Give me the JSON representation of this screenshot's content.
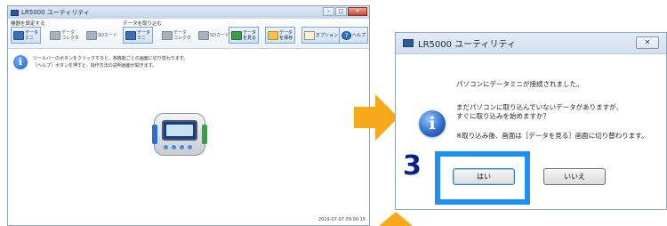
{
  "app": {
    "title": "LR5000 ユーティリティ",
    "window_buttons": {
      "minimize": "–",
      "maximize": "□",
      "close": "✕"
    },
    "toolbar": {
      "group1_label": "機器を設定する",
      "group2_label": "データを取り込む",
      "buttons": [
        {
          "label": "データ\nミニ",
          "icon": "data-mini-icon",
          "active": true
        },
        {
          "label": "データ\nコレクタ",
          "icon": "data-collector-icon",
          "active": false
        },
        {
          "label": "SDカード",
          "icon": "sd-card-icon",
          "active": false
        },
        {
          "label": "データ\nミニ",
          "icon": "data-mini-icon",
          "active": true
        },
        {
          "label": "データ\nコレクタ",
          "icon": "data-collector-icon",
          "active": false
        },
        {
          "label": "SDカード",
          "icon": "sd-card-icon",
          "active": false
        },
        {
          "label": "データ\nを見る",
          "icon": "view-data-icon",
          "active": true
        },
        {
          "label": "データ\nを保存",
          "icon": "save-data-icon",
          "active": true
        },
        {
          "label": "オプション",
          "icon": "options-icon",
          "active": true
        },
        {
          "label": "ヘルプ",
          "icon": "help-icon",
          "active": true
        }
      ]
    },
    "info_line1": "ツールバーのボタンをクリックすると、各機能ごとの画面に切り替わります。",
    "info_line2": "［ヘルプ］ボタンを押すと、操作方法の説明画面が開きます。",
    "timestamp": "2019-07-07 09:00:15"
  },
  "dialog": {
    "title": "LR5000 ユーティリティ",
    "close_label": "✕",
    "message_line1": "パソコンにデータミニが接続されました。",
    "message_line2": "まだパソコンに取り込んでいないデータがありますが、",
    "message_line3": "すぐに取り込みを始めますか？",
    "message_line4": "※取り込み後、画面は［データを見る］画面に切り替わります。",
    "yes_label": "はい",
    "no_label": "いいえ"
  },
  "annotation": {
    "step_number": "3",
    "highlight_color": "#1f90ef",
    "arrow_color": "#f7a81b",
    "step_color": "#0a1f8f"
  }
}
